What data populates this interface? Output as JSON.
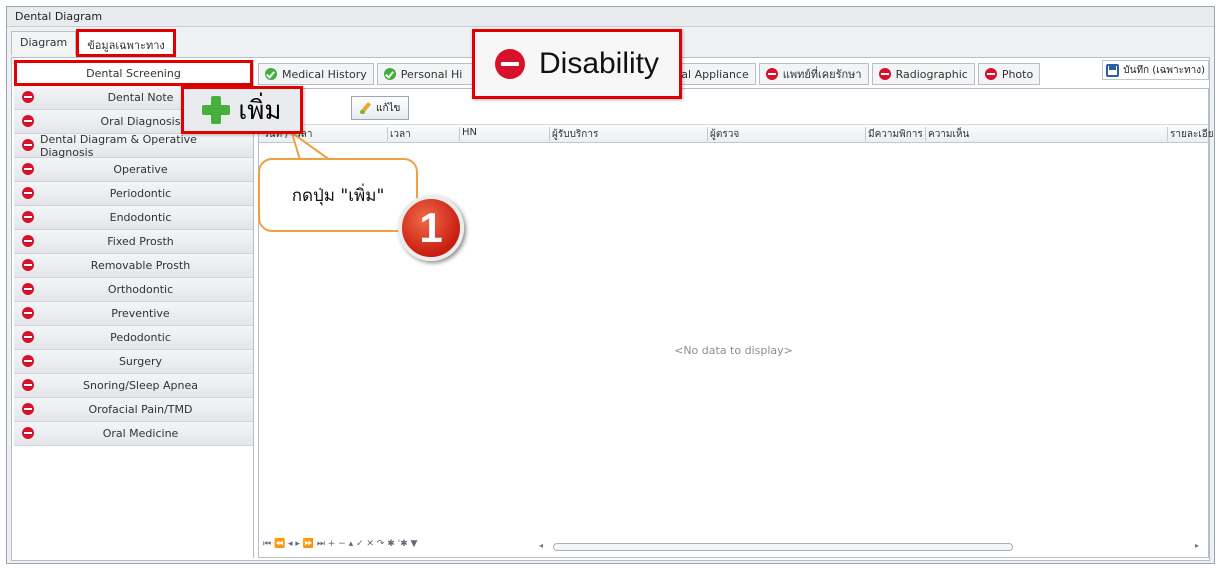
{
  "window": {
    "title": "Dental Diagram"
  },
  "top_tabs": [
    {
      "label": "Diagram"
    },
    {
      "label": "ข้อมูลเฉพาะทาง"
    }
  ],
  "sidebar": {
    "items": [
      {
        "label": "Dental Screening",
        "icon": "none",
        "active": true
      },
      {
        "label": "Dental Note",
        "icon": "stop-icon"
      },
      {
        "label": "Oral Diagnosis",
        "icon": "stop-icon"
      },
      {
        "label": "Dental Diagram & Operative Diagnosis",
        "icon": "stop-icon"
      },
      {
        "label": "Operative",
        "icon": "stop-icon"
      },
      {
        "label": "Periodontic",
        "icon": "stop-icon"
      },
      {
        "label": "Endodontic",
        "icon": "stop-icon"
      },
      {
        "label": "Fixed Prosth",
        "icon": "stop-icon"
      },
      {
        "label": "Removable Prosth",
        "icon": "stop-icon"
      },
      {
        "label": "Orthodontic",
        "icon": "stop-icon"
      },
      {
        "label": "Preventive",
        "icon": "stop-icon"
      },
      {
        "label": "Pedodontic",
        "icon": "stop-icon"
      },
      {
        "label": "Surgery",
        "icon": "stop-icon"
      },
      {
        "label": "Snoring/Sleep Apnea",
        "icon": "stop-icon"
      },
      {
        "label": "Orofacial Pain/TMD",
        "icon": "stop-icon"
      },
      {
        "label": "Oral Medicine",
        "icon": "stop-icon"
      }
    ]
  },
  "sub_tabs": [
    {
      "label": "Medical History",
      "icon": "check-icon"
    },
    {
      "label": "Personal Hi",
      "icon": "check-icon"
    },
    {
      "label": "e",
      "icon": "none"
    },
    {
      "label": "Dental Appliance",
      "icon": "stop-icon"
    },
    {
      "label": "แพทย์ที่เคยรักษา",
      "icon": "stop-icon"
    },
    {
      "label": "Radiographic",
      "icon": "stop-icon"
    },
    {
      "label": "Photo",
      "icon": "stop-icon"
    }
  ],
  "save_button": {
    "label": "บันทึก (เฉพาะทาง)",
    "icon": "floppy-icon"
  },
  "toolbar": {
    "edit_label": "แก้ไข",
    "add_label": "เพิ่ม"
  },
  "grid": {
    "columns": [
      "วันที่ / เวลา",
      "เวลา",
      "HN",
      "ผู้รับบริการ",
      "ผู้ตรวจ",
      "มีความพิการ",
      "ความเห็น",
      "รายละเอีย"
    ],
    "empty_text": "<No data to display>",
    "navigator": "⏮ ⏪ ◂ ▸ ⏩ ⏭ + − ▴ ✓ ✕ ↷ ✱ '✱ ▼"
  },
  "overlays": {
    "disability_label": "Disability",
    "callout_text": "กดปุ่ม \"เพิ่ม\"",
    "step_number": "1"
  },
  "colors": {
    "highlight": "#e00000",
    "stop": "#d8112a",
    "check": "#3fae3a",
    "callout_border": "#f0a040"
  }
}
